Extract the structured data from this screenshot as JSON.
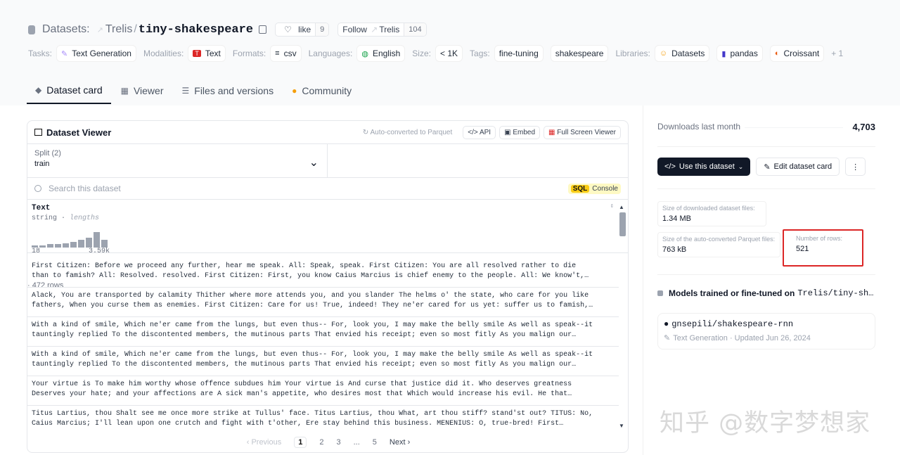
{
  "header": {
    "section_label": "Datasets:",
    "owner": "Trelis",
    "repo": "tiny-shakespeare",
    "like_label": "like",
    "like_count": "9",
    "follow_label": "Follow",
    "follow_owner": "Trelis",
    "follow_count": "104"
  },
  "tags": {
    "tasks_label": "Tasks:",
    "task": "Text Generation",
    "modalities_label": "Modalities:",
    "modality": "Text",
    "formats_label": "Formats:",
    "format": "csv",
    "languages_label": "Languages:",
    "language": "English",
    "size_label": "Size:",
    "size": "< 1K",
    "tags_label": "Tags:",
    "tag1": "fine-tuning",
    "tag2": "shakespeare",
    "libraries_label": "Libraries:",
    "lib1": "Datasets",
    "lib2": "pandas",
    "lib3": "Croissant",
    "more": "+ 1"
  },
  "tabs": [
    "Dataset card",
    "Viewer",
    "Files and versions",
    "Community"
  ],
  "viewer": {
    "title": "Dataset Viewer",
    "auto_converted": "Auto-converted to Parquet",
    "api": "API",
    "embed": "Embed",
    "fullscreen": "Full Screen Viewer",
    "split_label": "Split (2)",
    "split_name": "train",
    "split_rows": "· 472 rows",
    "search_placeholder": "Search this dataset",
    "sql_tag": "SQL",
    "console": "Console",
    "column_name": "Text",
    "column_type": "string",
    "column_sub": "lengths",
    "hist_min": "18",
    "hist_max": "3.59k",
    "rows": [
      [
        "First Citizen: Before we proceed any further, hear me speak. All: Speak, speak. First Citizen: You are all resolved rather to die",
        "than to famish? All: Resolved. resolved. First Citizen: First, you know Caius Marcius is chief enemy to the people. All: We know't,…"
      ],
      [
        "Alack, You are transported by calamity Thither where more attends you, and you slander The helms o' the state, who care for you like",
        "fathers, When you curse them as enemies. First Citizen: Care for us! True, indeed! They ne'er cared for us yet: suffer us to famish,…"
      ],
      [
        "With a kind of smile, Which ne'er came from the lungs, but even thus-- For, look you, I may make the belly smile As well as speak--it",
        "tauntingly replied To the discontented members, the mutinous parts That envied his receipt; even so most fitly As you malign our…"
      ],
      [
        "With a kind of smile, Which ne'er came from the lungs, but even thus-- For, look you, I may make the belly smile As well as speak--it",
        "tauntingly replied To the discontented members, the mutinous parts That envied his receipt; even so most fitly As you malign our…"
      ],
      [
        "Your virtue is To make him worthy whose offence subdues him Your virtue is And curse that justice did it. Who deserves greatness",
        "Deserves your hate; and your affections are A sick man's appetite, who desires most that Which would increase his evil. He that…"
      ],
      [
        "Titus Lartius, thou Shalt see me once more strike at Tullus' face. Titus Lartius, thou What, art thou stiff? stand'st out? TITUS: No,",
        "Caius Marcius; I'll lean upon one crutch and fight with t'other, Ere stay behind this business. MENENIUS: O, true-bred! First…"
      ]
    ],
    "pager": {
      "prev": "‹ Previous",
      "p1": "1",
      "p2": "2",
      "p3": "3",
      "ellipsis": "...",
      "p5": "5",
      "next": "Next ›"
    }
  },
  "sidebar": {
    "downloads_label": "Downloads last month",
    "downloads_value": "4,703",
    "use_button": "Use this dataset",
    "edit_button": "Edit dataset card",
    "more": "⋮",
    "size_download_label": "Size of downloaded dataset files:",
    "size_download_value": "1.34 MB",
    "size_parquet_label": "Size of the auto-converted Parquet files:",
    "size_parquet_value": "763 kB",
    "num_rows_label": "Number of rows:",
    "num_rows_value": "521",
    "models_title": "Models trained or fine-tuned on",
    "models_repo": "Trelis/tiny-sh…",
    "model_name": "gnsepili/shakespeare-rnn",
    "model_task": "Text Generation",
    "model_updated": "· Updated Jun 26, 2024"
  },
  "watermark": "知乎 @数字梦想家",
  "hist_bars": [
    2,
    2,
    3,
    3,
    4,
    5,
    7,
    9,
    14,
    7
  ]
}
